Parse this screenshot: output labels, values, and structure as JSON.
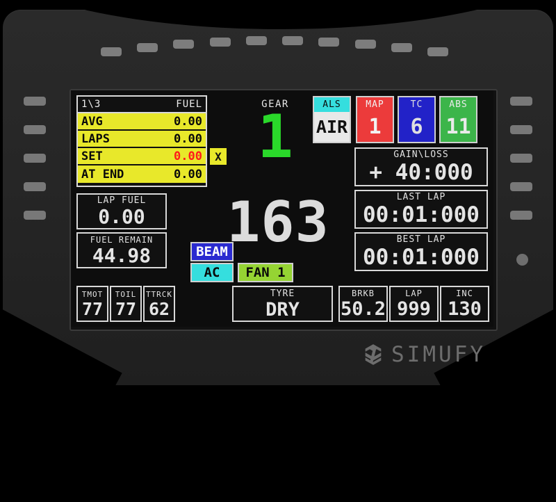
{
  "device": {
    "brand": "SIMUFY",
    "led_count": 10,
    "left_button_count": 5,
    "right_button_count": 5,
    "has_rotary_knob": true
  },
  "screen": {
    "fuel_panel": {
      "page_indicator": "1\\3",
      "title": "FUEL",
      "x_marker": "X",
      "rows": [
        {
          "label": "AVG",
          "value": "0.00",
          "value_color": "#0a0a0a"
        },
        {
          "label": "LAPS",
          "value": "0.00",
          "value_color": "#0a0a0a"
        },
        {
          "label": "SET",
          "value": "0.00",
          "value_color": "#ff1a1a"
        },
        {
          "label": "AT END",
          "value": "0.00",
          "value_color": "#0a0a0a"
        }
      ],
      "background": "#e8e82a"
    },
    "lap_fuel": {
      "label": "LAP FUEL",
      "value": "0.00"
    },
    "fuel_remain": {
      "label": "FUEL REMAIN",
      "value": "44.98"
    },
    "gear": {
      "label": "GEAR",
      "value": "1",
      "color": "#2ad82a"
    },
    "speed": {
      "value": "163"
    },
    "mode_boxes": [
      {
        "label": "ALS",
        "value": "AIR",
        "head_bg": "#35dede",
        "head_fg": "#0a0a0a",
        "body_bg": "#e8e8e8",
        "body_fg": "#111111"
      },
      {
        "label": "MAP",
        "value": "1",
        "head_bg": "#ec3b3b",
        "head_fg": "#f2f2f2",
        "body_bg": "#ec3b3b",
        "body_fg": "#f2f2f2"
      },
      {
        "label": "TC",
        "value": "6",
        "head_bg": "#2222c8",
        "head_fg": "#e0e0e0",
        "body_bg": "#2222c8",
        "body_fg": "#e0e0e0"
      },
      {
        "label": "ABS",
        "value": "11",
        "head_bg": "#3cb54a",
        "head_fg": "#eaeaea",
        "body_bg": "#3cb54a",
        "body_fg": "#eaeaea"
      }
    ],
    "timing": [
      {
        "label": "GAIN\\LOSS",
        "value": "+ 40:000"
      },
      {
        "label": "LAST LAP",
        "value": "00:01:000"
      },
      {
        "label": "BEST LAP",
        "value": "00:01:000"
      }
    ],
    "toggles": [
      {
        "label": "BEAM",
        "bg": "#2a2ad0",
        "fg": "#ffffff"
      },
      {
        "label": "AC",
        "bg": "#35dede",
        "fg": "#0a0a0a"
      },
      {
        "label": "FAN 1",
        "bg": "#95d433",
        "fg": "#0a0a0a"
      }
    ],
    "temps": [
      {
        "label": "TMOT",
        "value": "77"
      },
      {
        "label": "TOIL",
        "value": "77"
      },
      {
        "label": "TTRCK",
        "value": "62"
      }
    ],
    "tyre": {
      "label": "TYRE",
      "value": "DRY"
    },
    "bottom_right": [
      {
        "label": "BRKB",
        "value": "50.2"
      },
      {
        "label": "LAP",
        "value": "999"
      },
      {
        "label": "INC",
        "value": "130"
      }
    ]
  }
}
